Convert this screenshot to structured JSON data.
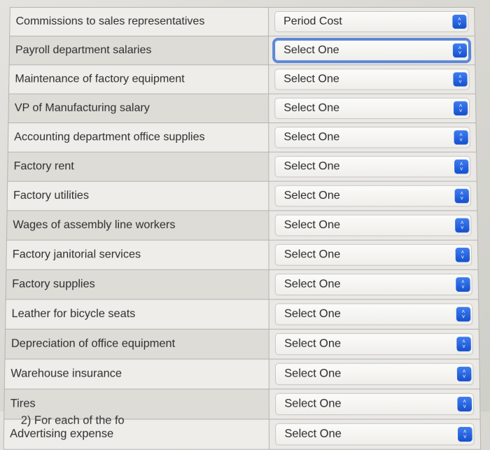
{
  "rows": [
    {
      "label": "Commissions to sales representatives",
      "value": "Period Cost",
      "focused": false
    },
    {
      "label": "Payroll department salaries",
      "value": "Select One",
      "focused": true
    },
    {
      "label": "Maintenance of factory equipment",
      "value": "Select One",
      "focused": false
    },
    {
      "label": "VP of Manufacturing salary",
      "value": "Select One",
      "focused": false
    },
    {
      "label": "Accounting department office supplies",
      "value": "Select One",
      "focused": false
    },
    {
      "label": "Factory rent",
      "value": "Select One",
      "focused": false
    },
    {
      "label": "Factory utilities",
      "value": "Select One",
      "focused": false
    },
    {
      "label": "Wages of assembly line workers",
      "value": "Select One",
      "focused": false
    },
    {
      "label": "Factory janitorial services",
      "value": "Select One",
      "focused": false
    },
    {
      "label": "Factory supplies",
      "value": "Select One",
      "focused": false
    },
    {
      "label": "Leather for bicycle seats",
      "value": "Select One",
      "focused": false
    },
    {
      "label": "Depreciation of office equipment",
      "value": "Select One",
      "focused": false
    },
    {
      "label": "Warehouse insurance",
      "value": "Select One",
      "focused": false
    },
    {
      "label": "Tires",
      "value": "Select One",
      "focused": false
    },
    {
      "label": "Advertising expense",
      "value": "Select One",
      "focused": false
    }
  ],
  "footer_partial": "2) For each of the fo",
  "colors": {
    "select_arrow": "#1f5fe0",
    "focus_ring": "#5d86d6"
  }
}
